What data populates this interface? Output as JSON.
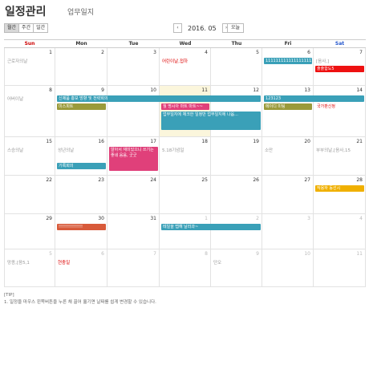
{
  "header": {
    "title": "일정관리",
    "subtitle": "업무일지"
  },
  "view_buttons": [
    "월간",
    "주간",
    "일간"
  ],
  "active_view": "월간",
  "nav": {
    "prev": "‹",
    "month": "2016. 05",
    "next": "›",
    "today": "오늘"
  },
  "weekdays": [
    "Sun",
    "Mon",
    "Tue",
    "Wed",
    "Thu",
    "Fri",
    "Sat"
  ],
  "weeks": [
    [
      {
        "day": "1",
        "dim": false,
        "note": "근로자의날",
        "red": false
      },
      {
        "day": "2",
        "dim": false
      },
      {
        "day": "3",
        "dim": false
      },
      {
        "day": "4",
        "dim": false,
        "note": "어린이날,접하",
        "red": true
      },
      {
        "day": "5",
        "dim": false
      },
      {
        "day": "6",
        "dim": false
      },
      {
        "day": "7",
        "dim": false,
        "note": "[음사,]",
        "red": false
      }
    ],
    [
      {
        "day": "8",
        "dim": false,
        "note": "어버이날",
        "red": false
      },
      {
        "day": "9",
        "dim": false
      },
      {
        "day": "10",
        "dim": false
      },
      {
        "day": "11",
        "dim": false,
        "today": true
      },
      {
        "day": "12",
        "dim": false
      },
      {
        "day": "13",
        "dim": false
      },
      {
        "day": "14",
        "dim": false
      }
    ],
    [
      {
        "day": "15",
        "dim": false,
        "note": "스승의날",
        "red": false
      },
      {
        "day": "16",
        "dim": false,
        "note": "성년의날",
        "red": false
      },
      {
        "day": "17",
        "dim": false
      },
      {
        "day": "18",
        "dim": false,
        "note": "5.18기념일",
        "red": false
      },
      {
        "day": "19",
        "dim": false
      },
      {
        "day": "20",
        "dim": false,
        "note": "소만",
        "red": false
      },
      {
        "day": "21",
        "dim": false,
        "note": "부부의날,[음사,15",
        "red": false
      }
    ],
    [
      {
        "day": "22",
        "dim": false
      },
      {
        "day": "23",
        "dim": false
      },
      {
        "day": "24",
        "dim": false
      },
      {
        "day": "25",
        "dim": false
      },
      {
        "day": "26",
        "dim": false
      },
      {
        "day": "27",
        "dim": false
      },
      {
        "day": "28",
        "dim": false
      }
    ],
    [
      {
        "day": "29",
        "dim": false
      },
      {
        "day": "30",
        "dim": false
      },
      {
        "day": "31",
        "dim": false
      },
      {
        "day": "1",
        "dim": true
      },
      {
        "day": "2",
        "dim": true
      },
      {
        "day": "3",
        "dim": true
      },
      {
        "day": "4",
        "dim": true
      }
    ],
    [
      {
        "day": "5",
        "dim": true,
        "note": "망종,[음5,1",
        "red": false
      },
      {
        "day": "6",
        "dim": true,
        "note": "현충일",
        "red": true
      },
      {
        "day": "7",
        "dim": true
      },
      {
        "day": "8",
        "dim": true
      },
      {
        "day": "9",
        "dim": true,
        "note": "단오",
        "red": false
      },
      {
        "day": "10",
        "dim": true
      },
      {
        "day": "11",
        "dim": true
      }
    ]
  ],
  "events": [
    {
      "week": 0,
      "start": 5,
      "span": 1,
      "row": 0,
      "text": "1111111111111111111111",
      "color": "#3aa0b8"
    },
    {
      "week": 0,
      "start": 6,
      "span": 1,
      "row": 1,
      "text": "출출합도5",
      "color": "#ee1111"
    },
    {
      "week": 1,
      "start": 1,
      "span": 4,
      "row": 0,
      "text": "신제품 홍보 방향 및 전략회의",
      "color": "#3aa0b8"
    },
    {
      "week": 1,
      "start": 5,
      "span": 2,
      "row": 0,
      "text": "123123",
      "color": "#3aa0b8"
    },
    {
      "week": 1,
      "start": 1,
      "span": 1,
      "row": 1,
      "text": "미스피트",
      "color": "#9a9a3a"
    },
    {
      "week": 1,
      "start": 3,
      "span": 1,
      "row": 1,
      "text": "월 명시아 마트 마트~~",
      "color": "#e0407a"
    },
    {
      "week": 1,
      "start": 5,
      "span": 1,
      "row": 1,
      "text": "메이디 미팅",
      "color": "#9a9a3a"
    },
    {
      "week": 1,
      "start": 6,
      "span": 1,
      "row": 1,
      "text": "국가판신청",
      "color": "",
      "red_text": true
    },
    {
      "week": 1,
      "start": 3,
      "span": 2,
      "row": 2,
      "text": "업무일지에 체크한 일정만 업무일지에 나옵...",
      "color": "#3aa0b8",
      "tall": true,
      "lines": 3
    },
    {
      "week": 2,
      "start": 2,
      "span": 1,
      "row": 0,
      "text": "알아서 재미있으니 쓰기는 좋네 음음, 굿굿",
      "color": "#e0407a",
      "tall": true,
      "lines": 4
    },
    {
      "week": 2,
      "start": 1,
      "span": 1,
      "row": 2,
      "text": "기록회의",
      "color": "#3aa0b8"
    },
    {
      "week": 3,
      "start": 6,
      "span": 1,
      "row": 0,
      "text": "작용하 동선시",
      "color": "#f0b000"
    },
    {
      "week": 4,
      "start": 1,
      "span": 1,
      "row": 0,
      "text": "!!!!!!!!!!!!!!!",
      "color": "#d85a3a"
    },
    {
      "week": 4,
      "start": 3,
      "span": 2,
      "row": 0,
      "text": "테일을 탭해 날라과~",
      "color": "#3aa0b8"
    }
  ],
  "tip": {
    "head": "[TIP]",
    "text": "1. 일정을 마우스 왼쪽버튼을 누른 채 끌어 옮기면 날짜를 쉽게 변경할 수 있습니다."
  }
}
